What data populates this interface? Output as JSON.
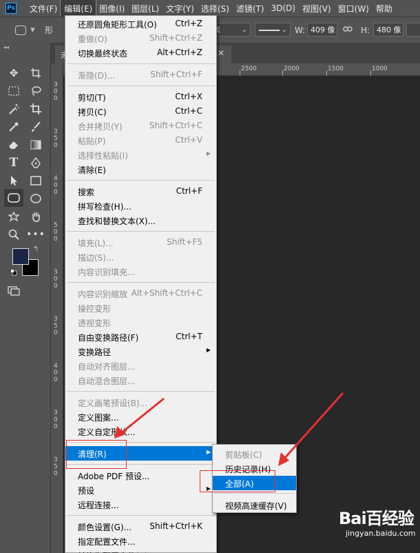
{
  "app": {
    "logo_text": "Ps"
  },
  "menubar": {
    "items": [
      "文件(F)",
      "编辑(E)",
      "图像(I)",
      "图层(L)",
      "文字(Y)",
      "选择(S)",
      "滤镜(T)",
      "3D(D)",
      "视图(V)",
      "窗口(W)",
      "帮助"
    ]
  },
  "options": {
    "mode_label": "形",
    "w_label": "W:",
    "w_value": "409 像",
    "h_label": "H:",
    "h_value": "480 像",
    "mode_fragment": "素"
  },
  "doc": {
    "tab_title": "未",
    "ruler_marks": [
      "2500",
      "2000",
      "1500",
      "1000"
    ],
    "ruler_left_groups": [
      [
        "3",
        "0",
        "0"
      ],
      [
        "3",
        "5",
        "0"
      ],
      [
        "4",
        "0",
        "0"
      ],
      [
        "5",
        "0",
        "0"
      ],
      [
        "3",
        "0",
        "0"
      ],
      [
        "3",
        "5",
        "0"
      ],
      [
        "4",
        "0",
        "0"
      ],
      [
        "3",
        "0",
        "0"
      ],
      [
        "3",
        "5",
        "0"
      ]
    ]
  },
  "edit_menu": {
    "groups": [
      [
        {
          "label": "还原圆角矩形工具(O)",
          "shortcut": "Ctrl+Z",
          "disabled": false
        },
        {
          "label": "重做(O)",
          "shortcut": "Shift+Ctrl+Z",
          "disabled": true
        },
        {
          "label": "切换最终状态",
          "shortcut": "Alt+Ctrl+Z",
          "disabled": false
        }
      ],
      [
        {
          "label": "渐隐(D)...",
          "shortcut": "Shift+Ctrl+F",
          "disabled": true
        }
      ],
      [
        {
          "label": "剪切(T)",
          "shortcut": "Ctrl+X",
          "disabled": false
        },
        {
          "label": "拷贝(C)",
          "shortcut": "Ctrl+C",
          "disabled": false
        },
        {
          "label": "合并拷贝(Y)",
          "shortcut": "Shift+Ctrl+C",
          "disabled": true
        },
        {
          "label": "粘贴(P)",
          "shortcut": "Ctrl+V",
          "disabled": true
        },
        {
          "label": "选择性粘贴(I)",
          "shortcut": "",
          "disabled": true,
          "submenu": true
        },
        {
          "label": "清除(E)",
          "shortcut": "",
          "disabled": false
        }
      ],
      [
        {
          "label": "搜索",
          "shortcut": "Ctrl+F",
          "disabled": false
        },
        {
          "label": "拼写检查(H)...",
          "shortcut": "",
          "disabled": false
        },
        {
          "label": "查找和替换文本(X)...",
          "shortcut": "",
          "disabled": false
        }
      ],
      [
        {
          "label": "填充(L)...",
          "shortcut": "Shift+F5",
          "disabled": true
        },
        {
          "label": "描边(S)...",
          "shortcut": "",
          "disabled": true
        },
        {
          "label": "内容识别填充...",
          "shortcut": "",
          "disabled": true
        }
      ],
      [
        {
          "label": "内容识别缩放",
          "shortcut": "Alt+Shift+Ctrl+C",
          "disabled": true
        },
        {
          "label": "操控变形",
          "shortcut": "",
          "disabled": true
        },
        {
          "label": "透视变形",
          "shortcut": "",
          "disabled": true
        },
        {
          "label": "自由变换路径(F)",
          "shortcut": "Ctrl+T",
          "disabled": false
        },
        {
          "label": "变换路径",
          "shortcut": "",
          "disabled": false,
          "submenu": true
        },
        {
          "label": "自动对齐图层...",
          "shortcut": "",
          "disabled": true
        },
        {
          "label": "自动混合图层...",
          "shortcut": "",
          "disabled": true
        }
      ],
      [
        {
          "label": "定义画笔预设(B)...",
          "shortcut": "",
          "disabled": true
        },
        {
          "label": "定义图案...",
          "shortcut": "",
          "disabled": false
        },
        {
          "label": "定义自定形状...",
          "shortcut": "",
          "disabled": false
        }
      ],
      [
        {
          "label": "清理(R)",
          "shortcut": "",
          "disabled": false,
          "submenu": true,
          "highlighted": true
        }
      ],
      [
        {
          "label": "Adobe PDF 预设...",
          "shortcut": "",
          "disabled": false
        },
        {
          "label": "预设",
          "shortcut": "",
          "disabled": false,
          "submenu": true
        },
        {
          "label": "远程连接...",
          "shortcut": "",
          "disabled": false
        }
      ],
      [
        {
          "label": "颜色设置(G)...",
          "shortcut": "Shift+Ctrl+K",
          "disabled": false
        },
        {
          "label": "指定配置文件...",
          "shortcut": "",
          "disabled": false
        },
        {
          "label": "转换为配置文件(V)...",
          "shortcut": "",
          "disabled": false
        }
      ]
    ]
  },
  "purge_submenu": {
    "items": [
      {
        "label": "剪贴板(C)",
        "disabled": true
      },
      {
        "label": "历史记录(H)",
        "disabled": false
      },
      {
        "label": "全部(A)",
        "disabled": false,
        "highlighted": true
      },
      {
        "label": "视频高速缓存(V)",
        "disabled": false
      }
    ]
  },
  "watermark": {
    "brand": "Bai百经验",
    "domain": "jingyan.baidu.com"
  },
  "colors": {
    "accent": "#0078d7",
    "annotation": "#e53030",
    "foreground_swatch": "#1c2448"
  }
}
